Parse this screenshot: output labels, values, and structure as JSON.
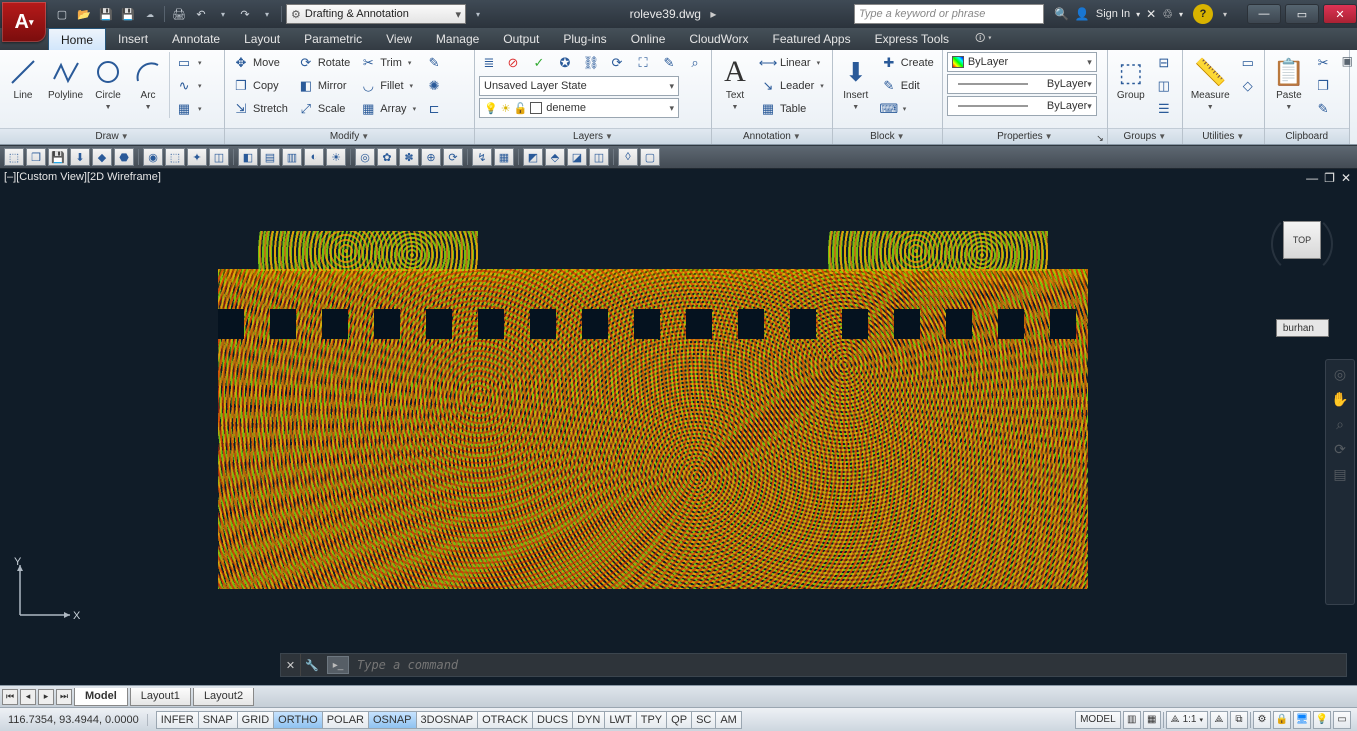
{
  "titlebar": {
    "workspace_label": "Drafting & Annotation",
    "filename": "roleve39.dwg",
    "search_placeholder": "Type a keyword or phrase",
    "signin_label": "Sign In"
  },
  "tabs": [
    "Home",
    "Insert",
    "Annotate",
    "Layout",
    "Parametric",
    "View",
    "Manage",
    "Output",
    "Plug-ins",
    "Online",
    "CloudWorx",
    "Featured Apps",
    "Express Tools"
  ],
  "active_tab": "Home",
  "ribbon": {
    "draw": {
      "title": "Draw",
      "line": "Line",
      "polyline": "Polyline",
      "circle": "Circle",
      "arc": "Arc"
    },
    "modify": {
      "title": "Modify",
      "move": "Move",
      "rotate": "Rotate",
      "trim": "Trim",
      "copy": "Copy",
      "mirror": "Mirror",
      "fillet": "Fillet",
      "stretch": "Stretch",
      "scale": "Scale",
      "array": "Array"
    },
    "layers": {
      "title": "Layers",
      "state": "Unsaved Layer State",
      "current_layer": "deneme"
    },
    "annotation": {
      "title": "Annotation",
      "text": "Text",
      "linear": "Linear",
      "leader": "Leader",
      "table": "Table"
    },
    "block": {
      "title": "Block",
      "insert": "Insert",
      "create": "Create",
      "edit": "Edit"
    },
    "properties": {
      "title": "Properties",
      "color": "ByLayer",
      "ltype": "ByLayer",
      "lweight": "ByLayer"
    },
    "groups": {
      "title": "Groups",
      "group": "Group"
    },
    "utilities": {
      "title": "Utilities",
      "measure": "Measure"
    },
    "clipboard": {
      "title": "Clipboard",
      "paste": "Paste"
    }
  },
  "viewport": {
    "view_controls": "[–][Custom View][2D Wireframe]",
    "cube_face": "TOP",
    "layer_state_tag": "burhan",
    "command_placeholder": "Type a command"
  },
  "layout_tabs": [
    "Model",
    "Layout1",
    "Layout2"
  ],
  "active_layout": "Model",
  "status": {
    "coords": "116.7354, 93.4944, 0.0000",
    "toggles": [
      "INFER",
      "SNAP",
      "GRID",
      "ORTHO",
      "POLAR",
      "OSNAP",
      "3DOSNAP",
      "OTRACK",
      "DUCS",
      "DYN",
      "LWT",
      "TPY",
      "QP",
      "SC",
      "AM"
    ],
    "toggles_on": [
      "ORTHO",
      "OSNAP"
    ],
    "model_btn": "MODEL",
    "scale": "1:1"
  }
}
